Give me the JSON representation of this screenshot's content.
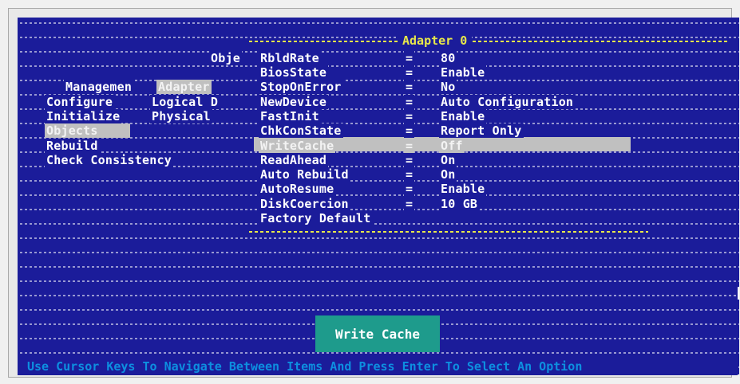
{
  "menu": {
    "objects_partial": "Obje",
    "management": "Managemen",
    "adapter": "Adapter",
    "configure": "Configure",
    "logical": "Logical D",
    "initialize": "Initialize",
    "physical": "Physical",
    "objects": "Objects",
    "rebuild": "Rebuild",
    "check_consistency": "Check Consistency"
  },
  "panel": {
    "title": "Adapter 0",
    "rows": [
      {
        "name": "RbldRate",
        "eq": "=",
        "value": "80"
      },
      {
        "name": "BiosState",
        "eq": "=",
        "value": "Enable"
      },
      {
        "name": "StopOnError",
        "eq": "=",
        "value": "No"
      },
      {
        "name": "NewDevice",
        "eq": "=",
        "value": "Auto Configuration"
      },
      {
        "name": "FastInit",
        "eq": "=",
        "value": "Enable"
      },
      {
        "name": "ChkConState",
        "eq": "=",
        "value": "Report Only"
      },
      {
        "name": "WriteCache",
        "eq": "=",
        "value": "Off"
      },
      {
        "name": "ReadAhead",
        "eq": "=",
        "value": "On"
      },
      {
        "name": "Auto Rebuild",
        "eq": "=",
        "value": "On"
      },
      {
        "name": "AutoResume",
        "eq": "=",
        "value": "Enable"
      },
      {
        "name": "DiskCoercion",
        "eq": "=",
        "value": "10 GB"
      },
      {
        "name": "Factory Default",
        "eq": "",
        "value": ""
      }
    ]
  },
  "hint_button": "Write Cache",
  "status_bar": "Use Cursor Keys To Navigate Between Items And Press Enter To Select An Option",
  "colors": {
    "screen_bg": "#1b1c9a",
    "text": "#ffffff",
    "border_accent": "#e8e84a",
    "selection": "#c0c0c0",
    "hint_bg": "#1e9b8c",
    "status_text": "#0d8fe0"
  }
}
